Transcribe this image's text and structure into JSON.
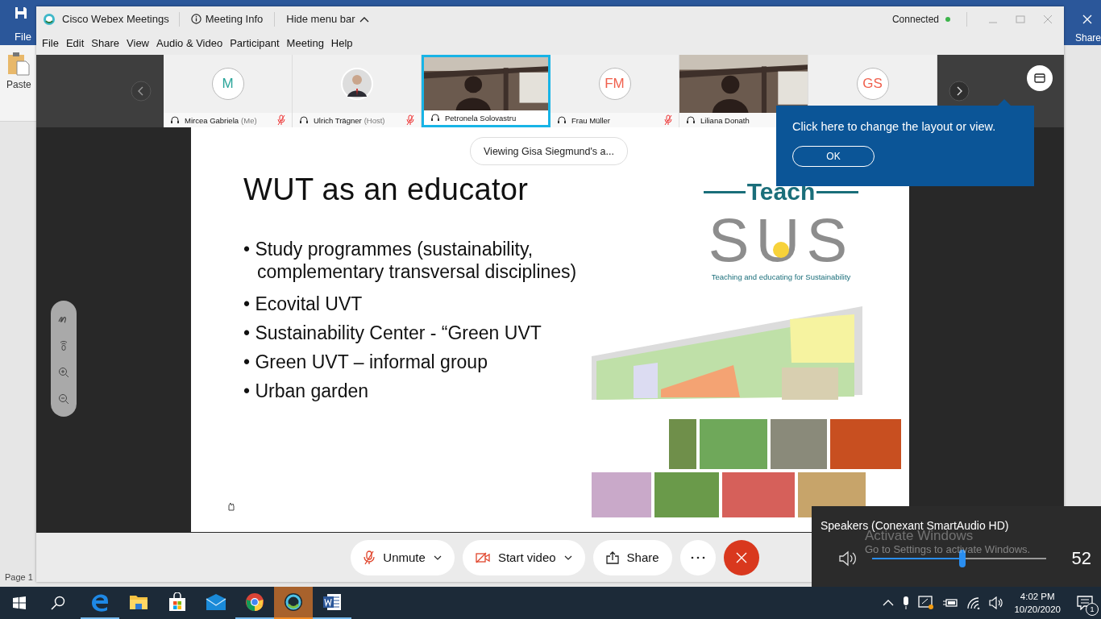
{
  "background_window": {
    "file_tab": "File",
    "paste": "Paste",
    "share": "Share",
    "status": "Page 1"
  },
  "webex": {
    "title": "Cisco Webex Meetings",
    "meeting_info": "Meeting Info",
    "hide_menu": "Hide menu bar",
    "status": "Connected",
    "connected": true,
    "menu": [
      "File",
      "Edit",
      "Share",
      "View",
      "Audio & Video",
      "Participant",
      "Meeting",
      "Help"
    ],
    "participants": [
      {
        "kind": "initials",
        "initials": "M",
        "color": "#2aa59a",
        "name": "Mircea Gabriela",
        "role": "(Me)",
        "muted": true,
        "selected": false
      },
      {
        "name": "Ulrich Trägner",
        "role": "(Host)",
        "muted": true,
        "selected": false
      },
      {
        "kind": "video",
        "name": "Petronela Solovastru",
        "muted": false,
        "selected": true
      },
      {
        "kind": "initials",
        "initials": "FM",
        "color": "#f0604d",
        "name": "Frau Müller",
        "muted": true,
        "selected": false
      },
      {
        "kind": "video",
        "name": "Liliana Donath",
        "muted": false,
        "selected": false
      },
      {
        "kind": "initials",
        "initials": "GS",
        "color": "#f0604d",
        "selected": false
      }
    ],
    "sharing_banner": "Viewing Gisa Siegmund's a...",
    "tooltip": {
      "text": "Click here to change the layout or view.",
      "button": "OK"
    },
    "slide": {
      "title": "WUT as an educator",
      "bullets": [
        "• Study programmes (sustainability, complementary transversal disciplines)",
        "• Ecovital UVT",
        "• Sustainability Center - “Green UVT",
        "• Green UVT – informal group",
        "• Urban garden"
      ],
      "logo": {
        "word": "Teach",
        "letters": "SUS",
        "tagline": "Teaching and educating for Sustainability"
      },
      "image": {
        "kind": "picture"
      }
    },
    "controls": [
      {
        "kind": "mute",
        "label": "Unmute",
        "dropdown": true
      },
      {
        "kind": "video",
        "label": "Start video",
        "dropdown": true
      },
      {
        "kind": "share",
        "label": "Share",
        "dropdown": false
      },
      {
        "kind": "more"
      },
      {
        "kind": "end"
      }
    ]
  },
  "volume": {
    "device": "Speakers (Conexant SmartAudio HD)",
    "level": 0.52,
    "reading": "52"
  },
  "activation_notice": {
    "title": "Activate Windows",
    "text": "Go to Settings to activate Windows."
  },
  "taskbar": {
    "apps": [
      {
        "kind": "edge",
        "running": true,
        "selected": false
      },
      {
        "kind": "explorer",
        "running": false,
        "selected": false
      },
      {
        "kind": "store",
        "running": false,
        "selected": false
      },
      {
        "kind": "mail",
        "running": false,
        "selected": false
      },
      {
        "kind": "chrome",
        "running": true,
        "selected": false
      },
      {
        "kind": "webex",
        "running": true,
        "selected": true
      },
      {
        "kind": "word",
        "running": true,
        "selected": false
      }
    ],
    "time": "4:02 PM",
    "date": "10/20/2020",
    "notifications": "1"
  }
}
